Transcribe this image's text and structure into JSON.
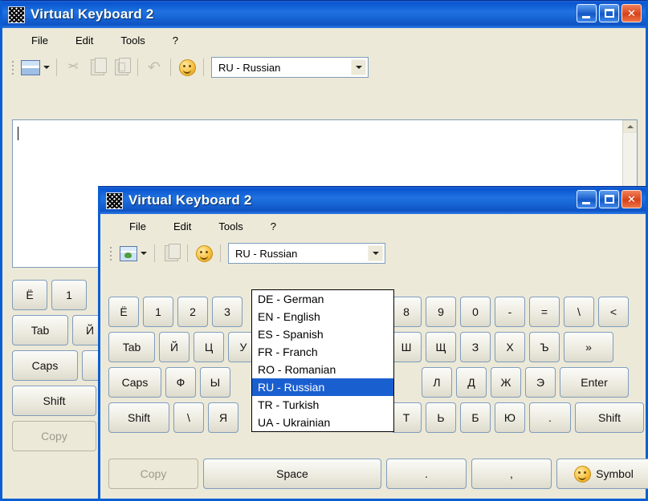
{
  "window1": {
    "title": "Virtual Keyboard 2",
    "icon": "checker-app-icon",
    "buttons": {
      "minimize": "minimize-button",
      "maximize": "maximize-button",
      "close": "close-button"
    },
    "menu": [
      "File",
      "Edit",
      "Tools",
      "?"
    ],
    "toolbar": {
      "items": [
        "skin-dropdown-button",
        "cut-button",
        "copy-button",
        "paste-button",
        "undo-button",
        "symbol-button"
      ]
    },
    "language_combo": {
      "value": "RU - Russian"
    },
    "text_value": "",
    "keyboard": {
      "row1": [
        "Ё",
        "1"
      ],
      "row2": [
        "Tab",
        "Й"
      ],
      "row3": [
        "Caps"
      ],
      "row4": [
        "Shift"
      ],
      "bottom": [
        "Copy"
      ]
    }
  },
  "window2": {
    "title": "Virtual Keyboard 2",
    "icon": "checker-app-icon",
    "buttons": {
      "minimize": "minimize-button",
      "maximize": "maximize-button",
      "close": "close-button"
    },
    "menu": [
      "File",
      "Edit",
      "Tools",
      "?"
    ],
    "toolbar": {
      "items": [
        "picture-skin-dropdown-button",
        "paste-button",
        "symbol-button"
      ]
    },
    "language_combo": {
      "value": "RU - Russian"
    },
    "language_options": [
      "DE - German",
      "EN - English",
      "ES - Spanish",
      "FR - Franch",
      "RO - Romanian",
      "RU - Russian",
      "TR - Turkish",
      "UA - Ukrainian"
    ],
    "language_selected": "RU - Russian",
    "keyboard": {
      "row1_left": [
        "Ё",
        "1",
        "2",
        "3"
      ],
      "row1_right": [
        "8",
        "9",
        "0",
        "-",
        "=",
        "\\",
        "<"
      ],
      "row2_left": [
        "Tab",
        "Й",
        "Ц",
        "У"
      ],
      "row2_right": [
        "Ш",
        "Щ",
        "З",
        "Х",
        "Ъ",
        "»"
      ],
      "row3_left": [
        "Caps",
        "Ф",
        "Ы"
      ],
      "row3_right": [
        "Л",
        "Д",
        "Ж",
        "Э",
        "Enter"
      ],
      "row4_left": [
        "Shift",
        "\\",
        "Я"
      ],
      "row4_right": [
        "Т",
        "Ь",
        "Б",
        "Ю",
        ".",
        "Shift"
      ],
      "bottom": [
        "Copy",
        "Space",
        ".",
        ",",
        "Symbol"
      ]
    }
  },
  "colors": {
    "titlebar_blue": "#1a6ad9",
    "window_face": "#ece9d8",
    "frame_blue": "#0b5fd4",
    "selection_blue": "#1a5fd0",
    "close_red": "#d8431b"
  }
}
